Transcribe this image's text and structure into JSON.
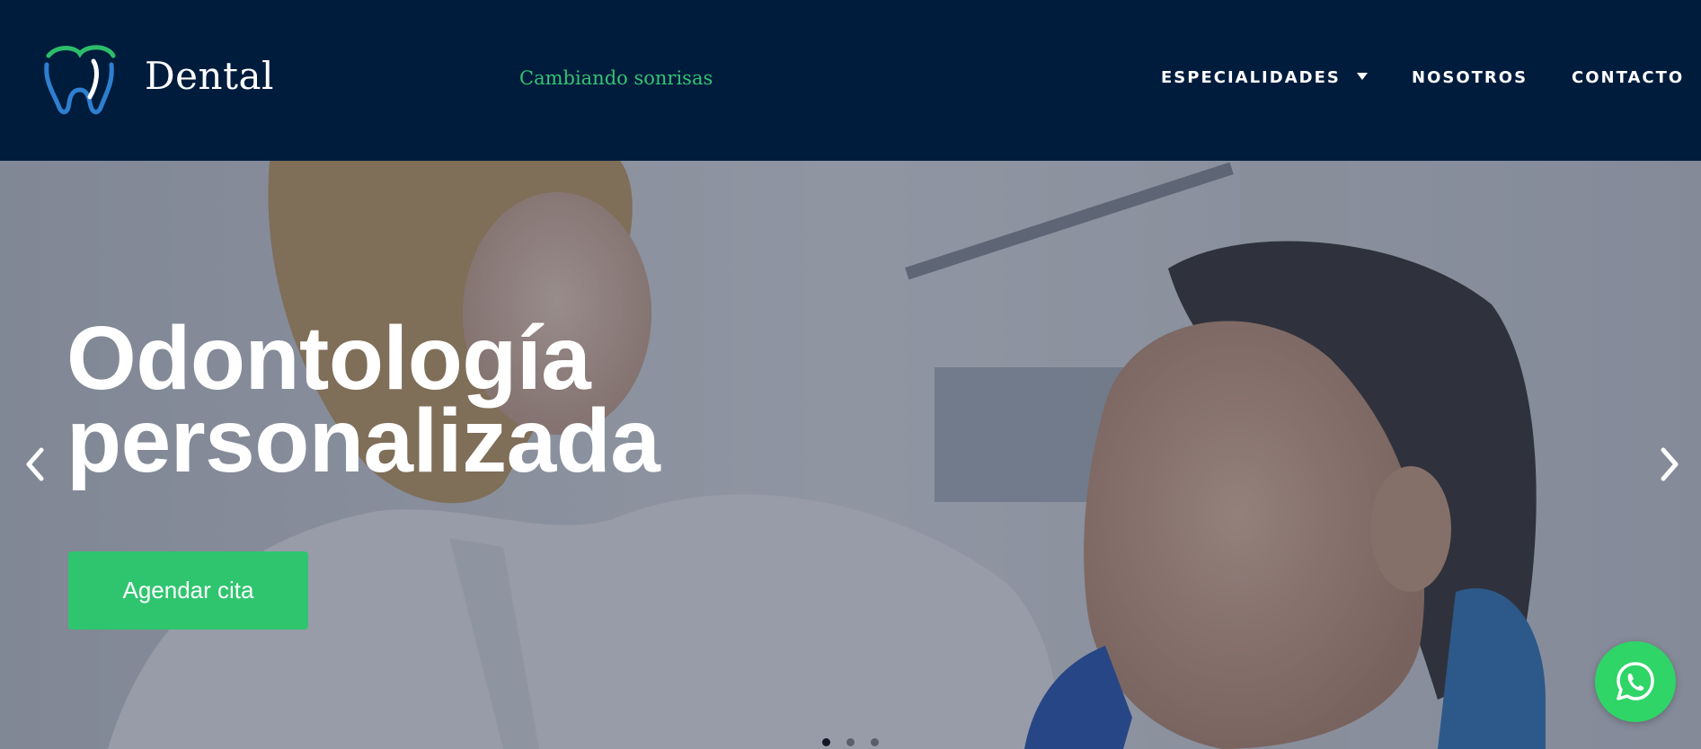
{
  "header": {
    "brand": "Dental",
    "tagline": "Cambiando sonrisas",
    "logo_icon": "tooth-logo-icon",
    "nav": [
      {
        "label": "ESPECIALIDADES",
        "has_dropdown": true
      },
      {
        "label": "NOSOTROS"
      },
      {
        "label": "CONTACTO"
      }
    ]
  },
  "hero": {
    "headline_line1": "Odontología",
    "headline_line2": "personalizada",
    "cta_label": "Agendar cita",
    "prev_icon": "chevron-left-icon",
    "next_icon": "chevron-right-icon",
    "slides_total": 3,
    "slide_active": 1,
    "image": "dentist-smiling-with-male-patient"
  },
  "floating": {
    "whatsapp_icon": "whatsapp-icon"
  },
  "colors": {
    "navy": "#001c3d",
    "accent_green": "#2fc56f",
    "tagline_green": "#33c472",
    "whatsapp_green": "#2fd567",
    "logo_blue": "#2f7fd0"
  }
}
